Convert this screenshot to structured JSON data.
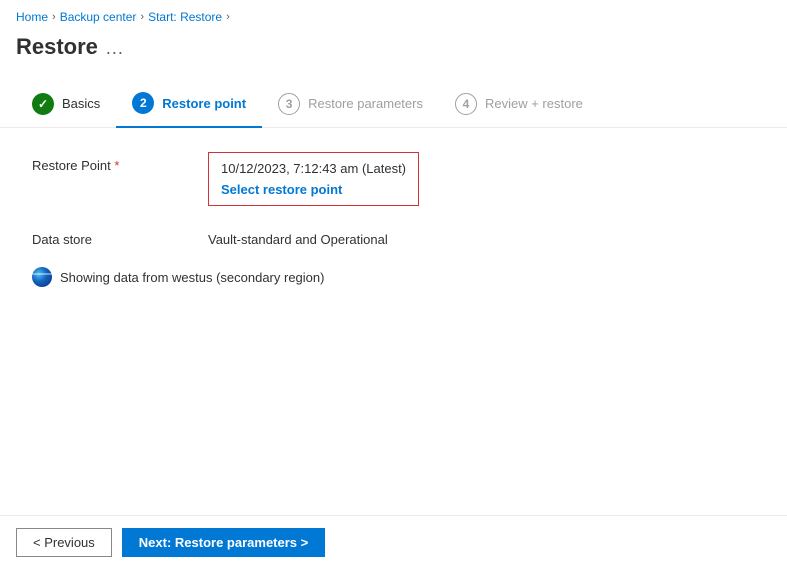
{
  "breadcrumb": {
    "items": [
      {
        "label": "Home",
        "link": true
      },
      {
        "label": "Backup center",
        "link": true
      },
      {
        "label": "Start: Restore",
        "link": true
      }
    ]
  },
  "page": {
    "title": "Restore",
    "ellipsis": "..."
  },
  "steps": [
    {
      "id": "basics",
      "number": "✓",
      "label": "Basics",
      "state": "done"
    },
    {
      "id": "restore-point",
      "number": "2",
      "label": "Restore point",
      "state": "active"
    },
    {
      "id": "restore-parameters",
      "number": "3",
      "label": "Restore parameters",
      "state": "inactive"
    },
    {
      "id": "review-restore",
      "number": "4",
      "label": "Review + restore",
      "state": "inactive"
    }
  ],
  "form": {
    "restore_point_label": "Restore Point",
    "restore_point_required": "*",
    "restore_point_value": "10/12/2023, 7:12:43 am (Latest)",
    "select_link_text": "Select restore point",
    "data_store_label": "Data store",
    "data_store_value": "Vault-standard and Operational",
    "info_text": "Showing data from westus (secondary region)"
  },
  "footer": {
    "previous_label": "< Previous",
    "next_label": "Next: Restore parameters >"
  }
}
